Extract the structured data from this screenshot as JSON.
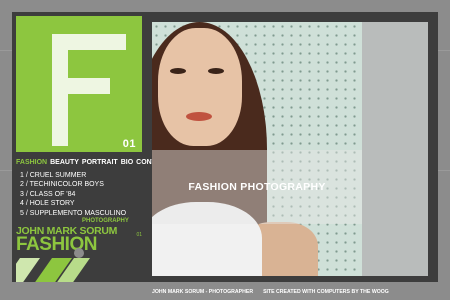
{
  "logo": {
    "letter": "F",
    "number": "01"
  },
  "nav": {
    "items": [
      "FASHION",
      "BEAUTY",
      "PORTRAIT",
      "BIO",
      "CONTACT"
    ],
    "active": "FASHION"
  },
  "gallery": {
    "items": [
      "1 / CRUEL SUMMER",
      "2 / TECHINICOLOR BOYS",
      "3 / CLASS OF '84",
      "4 / HOLE STORY",
      "5 / SUPPLEMENTO MASCULINO"
    ]
  },
  "title": {
    "top": "PHOTOGRAPHY",
    "name": "JOHN MARK SORUM",
    "section": "FASHION",
    "tag": "01"
  },
  "photo": {
    "caption": "FASHION PHOTOGRAPHY"
  },
  "footer": {
    "credit": "JOHN MARK SORUM - PHOTOGRAPHER",
    "site": "SITE CREATED WITH COMPUTERS BY THE WOOG"
  },
  "colors": {
    "accent": "#8dc63f",
    "frame": "#3d3d3d",
    "background": "#8c8c8c"
  },
  "icons": [
    "copyright-icon"
  ]
}
